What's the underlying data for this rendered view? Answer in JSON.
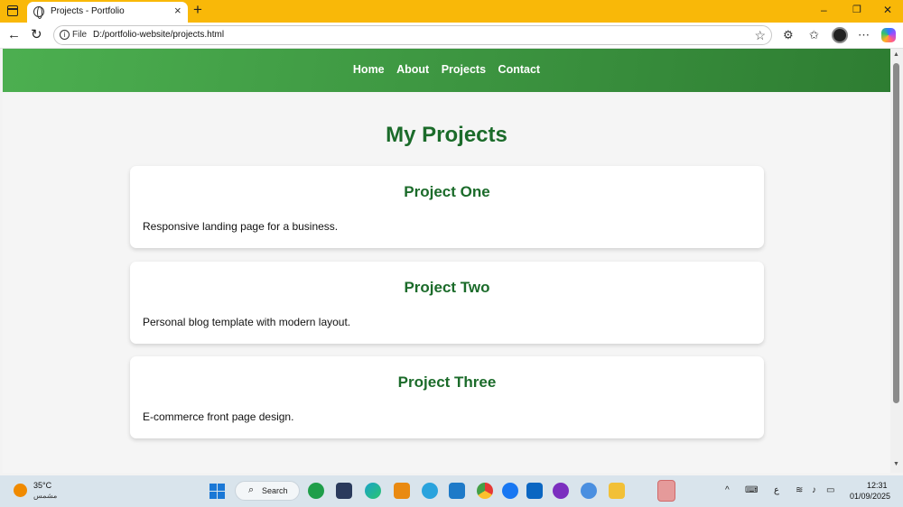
{
  "browser": {
    "tab_title": "Projects - Portfolio",
    "address_prefix": "File",
    "url": "D:/portfolio-website/projects.html"
  },
  "site": {
    "nav": [
      "Home",
      "About",
      "Projects",
      "Contact"
    ],
    "page_title": "My Projects",
    "projects": [
      {
        "title": "Project One",
        "description": "Responsive landing page for a business."
      },
      {
        "title": "Project Two",
        "description": "Personal blog template with modern layout."
      },
      {
        "title": "Project Three",
        "description": "E-commerce front page design."
      }
    ],
    "colors": {
      "header_start": "#4caf50",
      "header_end": "#2e7d32",
      "title": "#1b6b2a"
    }
  },
  "taskbar": {
    "weather_temp": "35°C",
    "weather_condition": "مشمس",
    "search_label": "Search",
    "input_indicator": "ع",
    "time": "12:31",
    "date": "01/09/2025"
  }
}
